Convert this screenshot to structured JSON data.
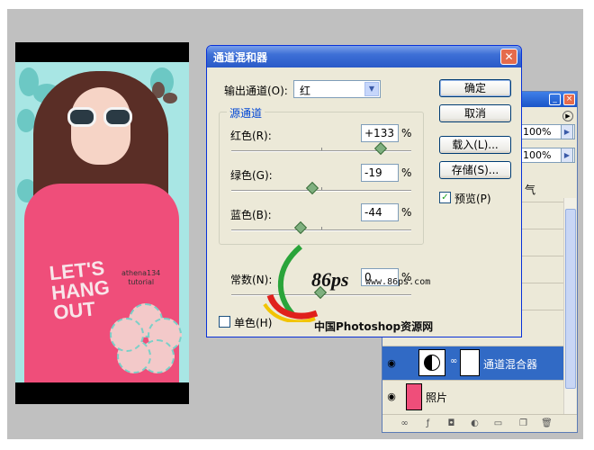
{
  "dialog": {
    "title": "通道混和器",
    "close_icon": "close-icon",
    "output_channel_label": "输出通道(O):",
    "output_channel_value": "红",
    "source_group_title": "源通道",
    "channels": [
      {
        "label": "红色(R):",
        "value": "+133",
        "unit": "%",
        "level": 133
      },
      {
        "label": "绿色(G):",
        "value": "-19",
        "unit": "%",
        "level": -19
      },
      {
        "label": "蓝色(B):",
        "value": "-44",
        "unit": "%",
        "level": -44
      }
    ],
    "constant": {
      "label": "常数(N):",
      "value": "0",
      "unit": "%",
      "level": 0
    },
    "monochrome_label": "单色(H)",
    "monochrome_checked": false,
    "buttons": {
      "ok": "确定",
      "cancel": "取消",
      "load": "载入(L)...",
      "save": "存储(S)..."
    },
    "preview_label": "预览(P)",
    "preview_checked": true
  },
  "layers": {
    "opacity1": "100%",
    "opacity2": "100%",
    "partial_text": "气",
    "rows": [
      {
        "name": "通道混合器",
        "selected": true
      },
      {
        "name": "照片",
        "selected": false
      }
    ]
  },
  "photo": {
    "shirt_text": "LET'S HANG OUT",
    "small_text_1": "athena134",
    "small_text_2": "tutorial"
  },
  "watermark": {
    "logo": "86ps",
    "url": "www.86ps.com",
    "name": "中国Photoshop资源网"
  }
}
